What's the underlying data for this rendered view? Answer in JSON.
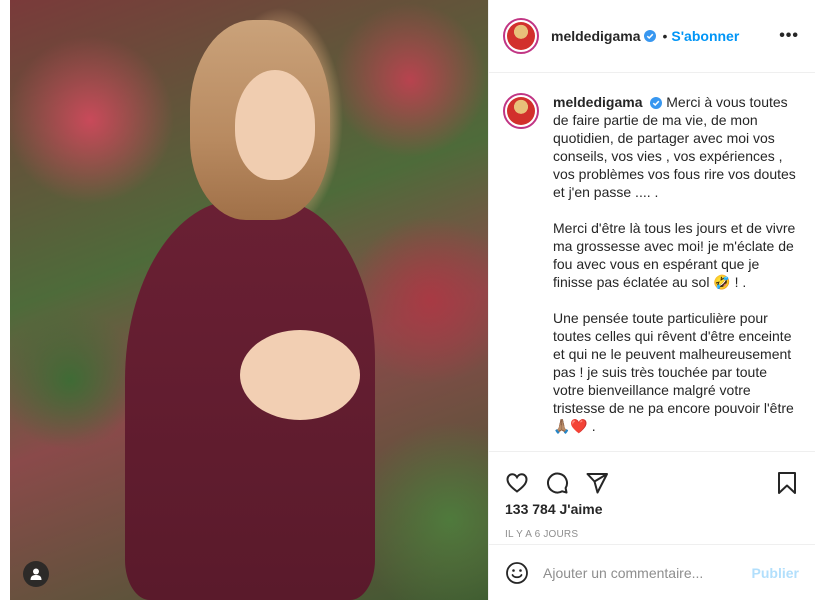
{
  "post": {
    "username": "meldedigama",
    "separator": "•",
    "follow_label": "S'abonner",
    "more_label": "•••",
    "caption_p1": "Merci à vous toutes de faire partie de ma vie, de mon quotidien, de partager avec moi vos conseils, vos vies , vos expériences , vos problèmes vos fous rire vos doutes et j'en passe .... .",
    "caption_p2": "Merci d'être là tous les jours et de vivre ma grossesse avec moi! je m'éclate de fou avec vous en espérant que je finisse pas éclatée au sol 🤣 ! .",
    "caption_p3": "Une pensée toute particulière pour toutes celles qui rêvent d'être enceinte et qui ne le peuvent malheureusement pas ! je suis très touchée par toute votre bienveillance malgré votre tristesse de ne pa encore pouvoir l'être 🙏🏽❤️ .",
    "likes": "133 784 J'aime",
    "time": "IL Y A 6 JOURS"
  },
  "comment": {
    "placeholder": "Ajouter un commentaire...",
    "publish_label": "Publier"
  },
  "icons": {
    "like": "heart-icon",
    "comment": "comment-icon",
    "share": "send-icon",
    "save": "bookmark-icon",
    "emoji": "smiley-icon",
    "tagged": "user-tag-icon",
    "verified": "verified-badge-icon"
  },
  "colors": {
    "accent": "#0095f6",
    "verified": "#3897f0",
    "publish_disabled": "#b2dffc"
  }
}
